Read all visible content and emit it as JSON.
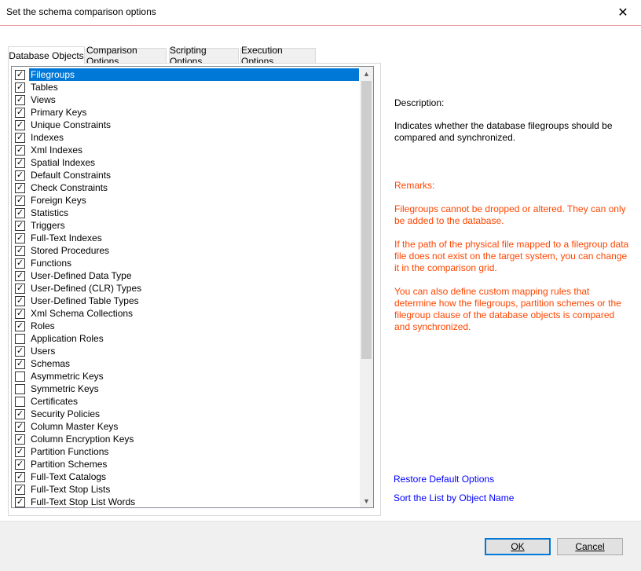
{
  "window": {
    "title": "Set the schema comparison options"
  },
  "tabs": [
    {
      "label": "Database Objects"
    },
    {
      "label": "Comparison Options"
    },
    {
      "label": "Scripting Options"
    },
    {
      "label": "Execution Options"
    }
  ],
  "list": {
    "items": [
      {
        "label": "Filegroups",
        "checked": true,
        "selected": true
      },
      {
        "label": "Tables",
        "checked": true
      },
      {
        "label": "Views",
        "checked": true
      },
      {
        "label": "Primary Keys",
        "checked": true
      },
      {
        "label": "Unique Constraints",
        "checked": true
      },
      {
        "label": "Indexes",
        "checked": true
      },
      {
        "label": "Xml Indexes",
        "checked": true
      },
      {
        "label": "Spatial Indexes",
        "checked": true
      },
      {
        "label": "Default Constraints",
        "checked": true
      },
      {
        "label": "Check Constraints",
        "checked": true
      },
      {
        "label": "Foreign Keys",
        "checked": true
      },
      {
        "label": "Statistics",
        "checked": true
      },
      {
        "label": "Triggers",
        "checked": true
      },
      {
        "label": "Full-Text Indexes",
        "checked": true
      },
      {
        "label": "Stored Procedures",
        "checked": true
      },
      {
        "label": "Functions",
        "checked": true
      },
      {
        "label": "User-Defined Data Type",
        "checked": true
      },
      {
        "label": "User-Defined (CLR) Types",
        "checked": true
      },
      {
        "label": "User-Defined Table Types",
        "checked": true
      },
      {
        "label": "Xml Schema Collections",
        "checked": true
      },
      {
        "label": "Roles",
        "checked": true
      },
      {
        "label": "Application Roles",
        "checked": false
      },
      {
        "label": "Users",
        "checked": true
      },
      {
        "label": "Schemas",
        "checked": true
      },
      {
        "label": "Asymmetric Keys",
        "checked": false
      },
      {
        "label": "Symmetric Keys",
        "checked": false
      },
      {
        "label": "Certificates",
        "checked": false
      },
      {
        "label": "Security Policies",
        "checked": true
      },
      {
        "label": "Column Master Keys",
        "checked": true
      },
      {
        "label": "Column Encryption Keys",
        "checked": true
      },
      {
        "label": "Partition Functions",
        "checked": true
      },
      {
        "label": "Partition Schemes",
        "checked": true
      },
      {
        "label": "Full-Text Catalogs",
        "checked": true
      },
      {
        "label": "Full-Text Stop Lists",
        "checked": true
      },
      {
        "label": "Full-Text Stop List Words",
        "checked": true
      }
    ]
  },
  "details": {
    "description_label": "Description:",
    "description_text": "Indicates whether the database filegroups should be compared and synchronized.",
    "remarks_label": "Remarks:",
    "remarks": [
      "Filegroups cannot be dropped or altered. They can only be added to the database.",
      "If the path of the physical file mapped to a filegroup data file does not exist on the target system, you can change it in the comparison grid.",
      "You can also define custom mapping rules that determine how the filegroups, partition schemes or the filegroup clause of the database objects is compared and synchronized."
    ],
    "remark_color": "#ff4500"
  },
  "links": {
    "restore": "Restore Default Options",
    "sort": "Sort the List by Object Name"
  },
  "buttons": {
    "ok": "OK",
    "cancel": "Cancel"
  },
  "colors": {
    "accent": "#0078d7",
    "link": "#0000ff"
  }
}
